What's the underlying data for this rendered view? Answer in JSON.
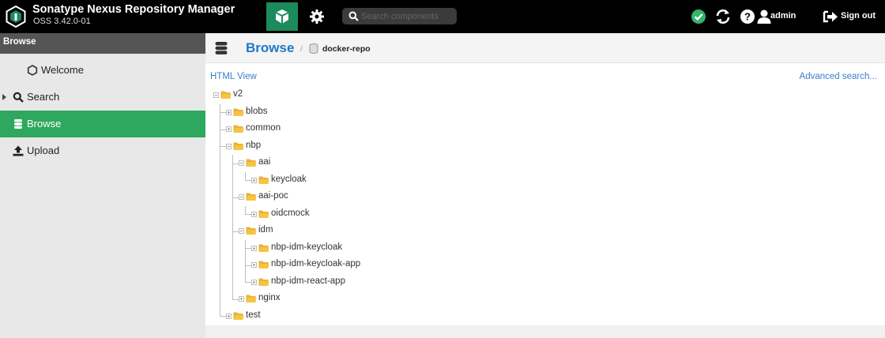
{
  "app": {
    "title": "Sonatype Nexus Repository Manager",
    "version": "OSS 3.42.0-01"
  },
  "header": {
    "search_placeholder": "Search components",
    "user": "admin",
    "signout_label": "Sign out",
    "icons": [
      "browse-box-icon",
      "gear-icon",
      "search-icon",
      "status-check-icon",
      "refresh-icon",
      "help-icon",
      "user-icon",
      "sign-out-icon"
    ]
  },
  "colors": {
    "accent_green": "#2fa85f",
    "header_bg": "#000000",
    "link_blue": "#3a82c4",
    "title_blue": "#1f78c8",
    "folder_yellow": "#f5c542"
  },
  "sidebar": {
    "header": "Browse",
    "items": [
      {
        "label": "Welcome",
        "icon": "welcome-icon",
        "active": false
      },
      {
        "label": "Search",
        "icon": "search-icon",
        "active": false,
        "expandable": true
      },
      {
        "label": "Browse",
        "icon": "database-icon",
        "active": true
      },
      {
        "label": "Upload",
        "icon": "upload-icon",
        "active": false
      }
    ]
  },
  "breadcrumb": {
    "title": "Browse",
    "separator": "/",
    "repo": "docker-repo"
  },
  "links": {
    "html_view": "HTML View",
    "advanced_search": "Advanced search..."
  },
  "tree": [
    {
      "label": "v2",
      "depth": 0,
      "expanded": true
    },
    {
      "label": "blobs",
      "depth": 1,
      "expanded": false
    },
    {
      "label": "common",
      "depth": 1,
      "expanded": false
    },
    {
      "label": "nbp",
      "depth": 1,
      "expanded": true
    },
    {
      "label": "aai",
      "depth": 2,
      "expanded": true
    },
    {
      "label": "keycloak",
      "depth": 3,
      "expanded": false
    },
    {
      "label": "aai-poc",
      "depth": 2,
      "expanded": true
    },
    {
      "label": "oidcmock",
      "depth": 3,
      "expanded": false
    },
    {
      "label": "idm",
      "depth": 2,
      "expanded": true
    },
    {
      "label": "nbp-idm-keycloak",
      "depth": 3,
      "expanded": false
    },
    {
      "label": "nbp-idm-keycloak-app",
      "depth": 3,
      "expanded": false
    },
    {
      "label": "nbp-idm-react-app",
      "depth": 3,
      "expanded": false
    },
    {
      "label": "nginx",
      "depth": 2,
      "expanded": false
    },
    {
      "label": "test",
      "depth": 1,
      "expanded": false
    }
  ]
}
